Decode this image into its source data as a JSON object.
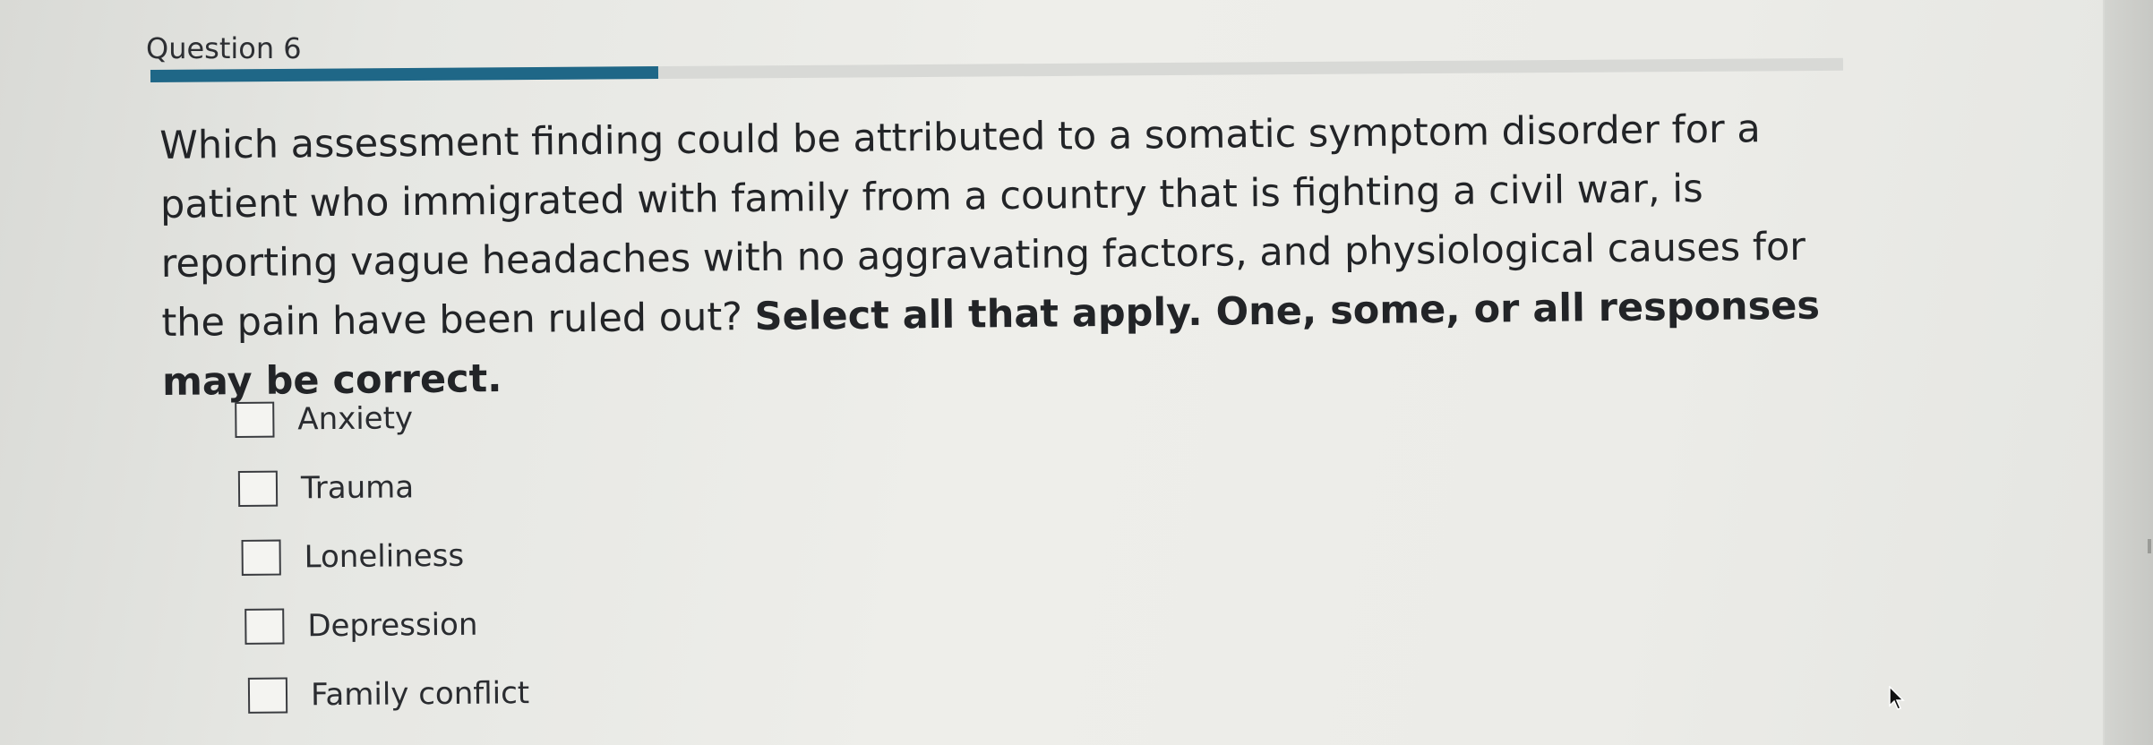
{
  "question": {
    "label": "Question 6",
    "progress": 0.3,
    "prompt_text": "Which assessment finding could be attributed to a somatic symptom disorder for a patient who immigrated with family from a country that is fighting a civil war, is reporting vague headaches with no aggravating factors, and physiological causes for the pain have been ruled out?",
    "instruction": "Select all that apply. One, some, or all responses may be correct."
  },
  "options": [
    {
      "label": "Anxiety",
      "checked": false
    },
    {
      "label": "Trauma",
      "checked": false
    },
    {
      "label": "Loneliness",
      "checked": false
    },
    {
      "label": "Depression",
      "checked": false
    },
    {
      "label": "Family conflict",
      "checked": false
    }
  ],
  "colors": {
    "progress_fill": "#1f6787",
    "progress_track": "#d8d9d6",
    "text": "#222427"
  },
  "icons": {
    "cursor": "mouse-pointer-icon"
  }
}
